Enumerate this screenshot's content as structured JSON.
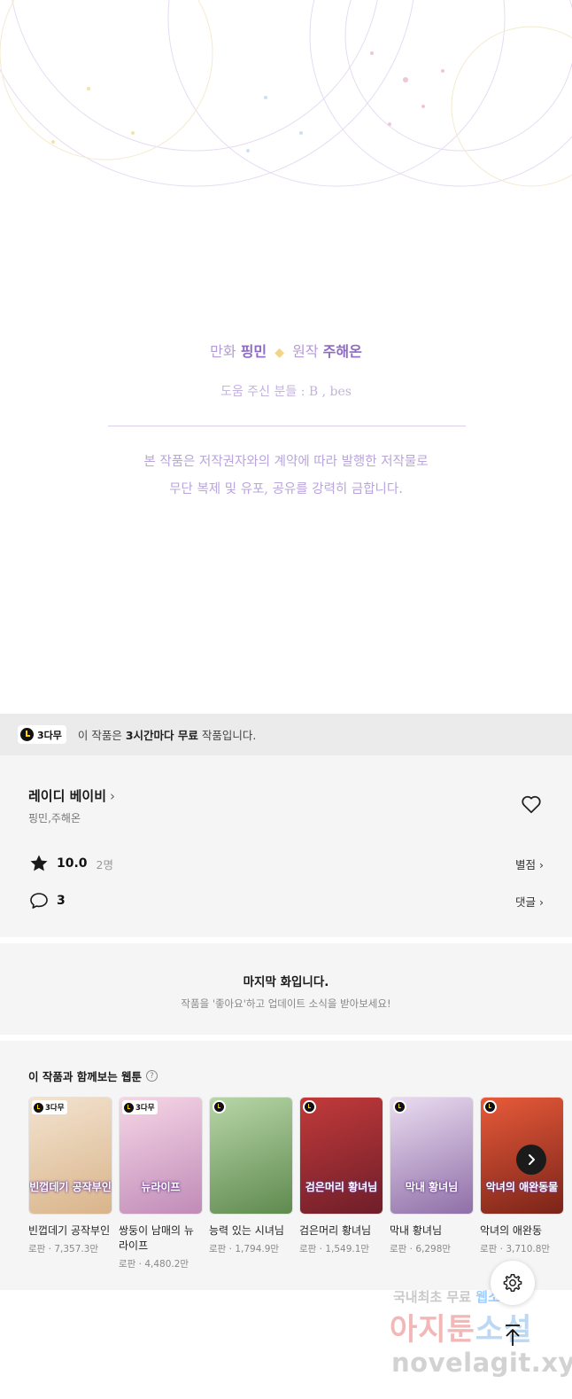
{
  "credits": {
    "label_art": "만화",
    "artist": "핑민",
    "diamond": "◆",
    "label_story": "원작",
    "writer": "주해온",
    "helpers": "도움 주신 분들 : B , bes",
    "notice_line1": "본 작품은 저작권자와의 계약에 따라 발행한 저작물로",
    "notice_line2": "무단 복제 및 유포, 공유를 강력히 금합니다."
  },
  "banner": {
    "badge": "3다무",
    "text_pre": "이 작품은 ",
    "text_bold": "3시간마다 무료",
    "text_post": " 작품입니다."
  },
  "work": {
    "title": "레이디 베이비",
    "title_chevron": "›",
    "authors": "핑민,주해온",
    "rating": "10.0",
    "rating_count": "2명",
    "rating_link": "별점 ›",
    "comments": "3",
    "comments_link": "댓글 ›"
  },
  "last_episode": {
    "title": "마지막 화입니다.",
    "subtitle": "작품을 '좋아요'하고 업데이트 소식을 받아보세요!"
  },
  "recommendations": {
    "title": "이 작품과 함께보는 웹툰",
    "help_icon": "?",
    "items": [
      {
        "name": "빈껍데기 공작부인",
        "meta": "로판 · 7,357.3만",
        "badge": "3다무",
        "art_title": "빈껍데기 공작부인",
        "colors": [
          "#f3e3d0",
          "#d9b48a"
        ]
      },
      {
        "name": "쌍둥이 남매의 뉴라이프",
        "meta": "로판 · 4,480.2만",
        "badge": "3다무",
        "art_title": "뉴라이프",
        "colors": [
          "#f6d6e6",
          "#c08bb8"
        ]
      },
      {
        "name": "능력 있는 시녀님",
        "meta": "로판 · 1,794.9만",
        "badge": "",
        "art_title": "",
        "colors": [
          "#b8d6a8",
          "#5f8a4f"
        ]
      },
      {
        "name": "검은머리 황녀님",
        "meta": "로판 · 1,549.1만",
        "badge": "",
        "art_title": "검은머리 황녀님",
        "colors": [
          "#c23a3a",
          "#6e1e2a"
        ]
      },
      {
        "name": "막내 황녀님",
        "meta": "로판 · 6,298만",
        "badge": "",
        "art_title": "막내 황녀님",
        "colors": [
          "#eadcf0",
          "#8f6fa8"
        ]
      },
      {
        "name": "악녀의 애완동",
        "meta": "로판 · 3,710.8만",
        "badge": "",
        "art_title": "악녀의 애완동물",
        "colors": [
          "#e85a3a",
          "#7a2418"
        ]
      }
    ]
  },
  "watermark": {
    "line1_a": "국내최초 무료 ",
    "line1_b": "웹소설",
    "line2_a": "아지툰",
    "line2_b": "소설",
    "line3": "novelagit.xyz"
  },
  "icons": {
    "heart": "heart-icon",
    "star": "star-icon",
    "comment": "comment-icon",
    "settings": "gear-icon",
    "top": "arrow-up-icon",
    "next": "chevron-right-icon"
  }
}
